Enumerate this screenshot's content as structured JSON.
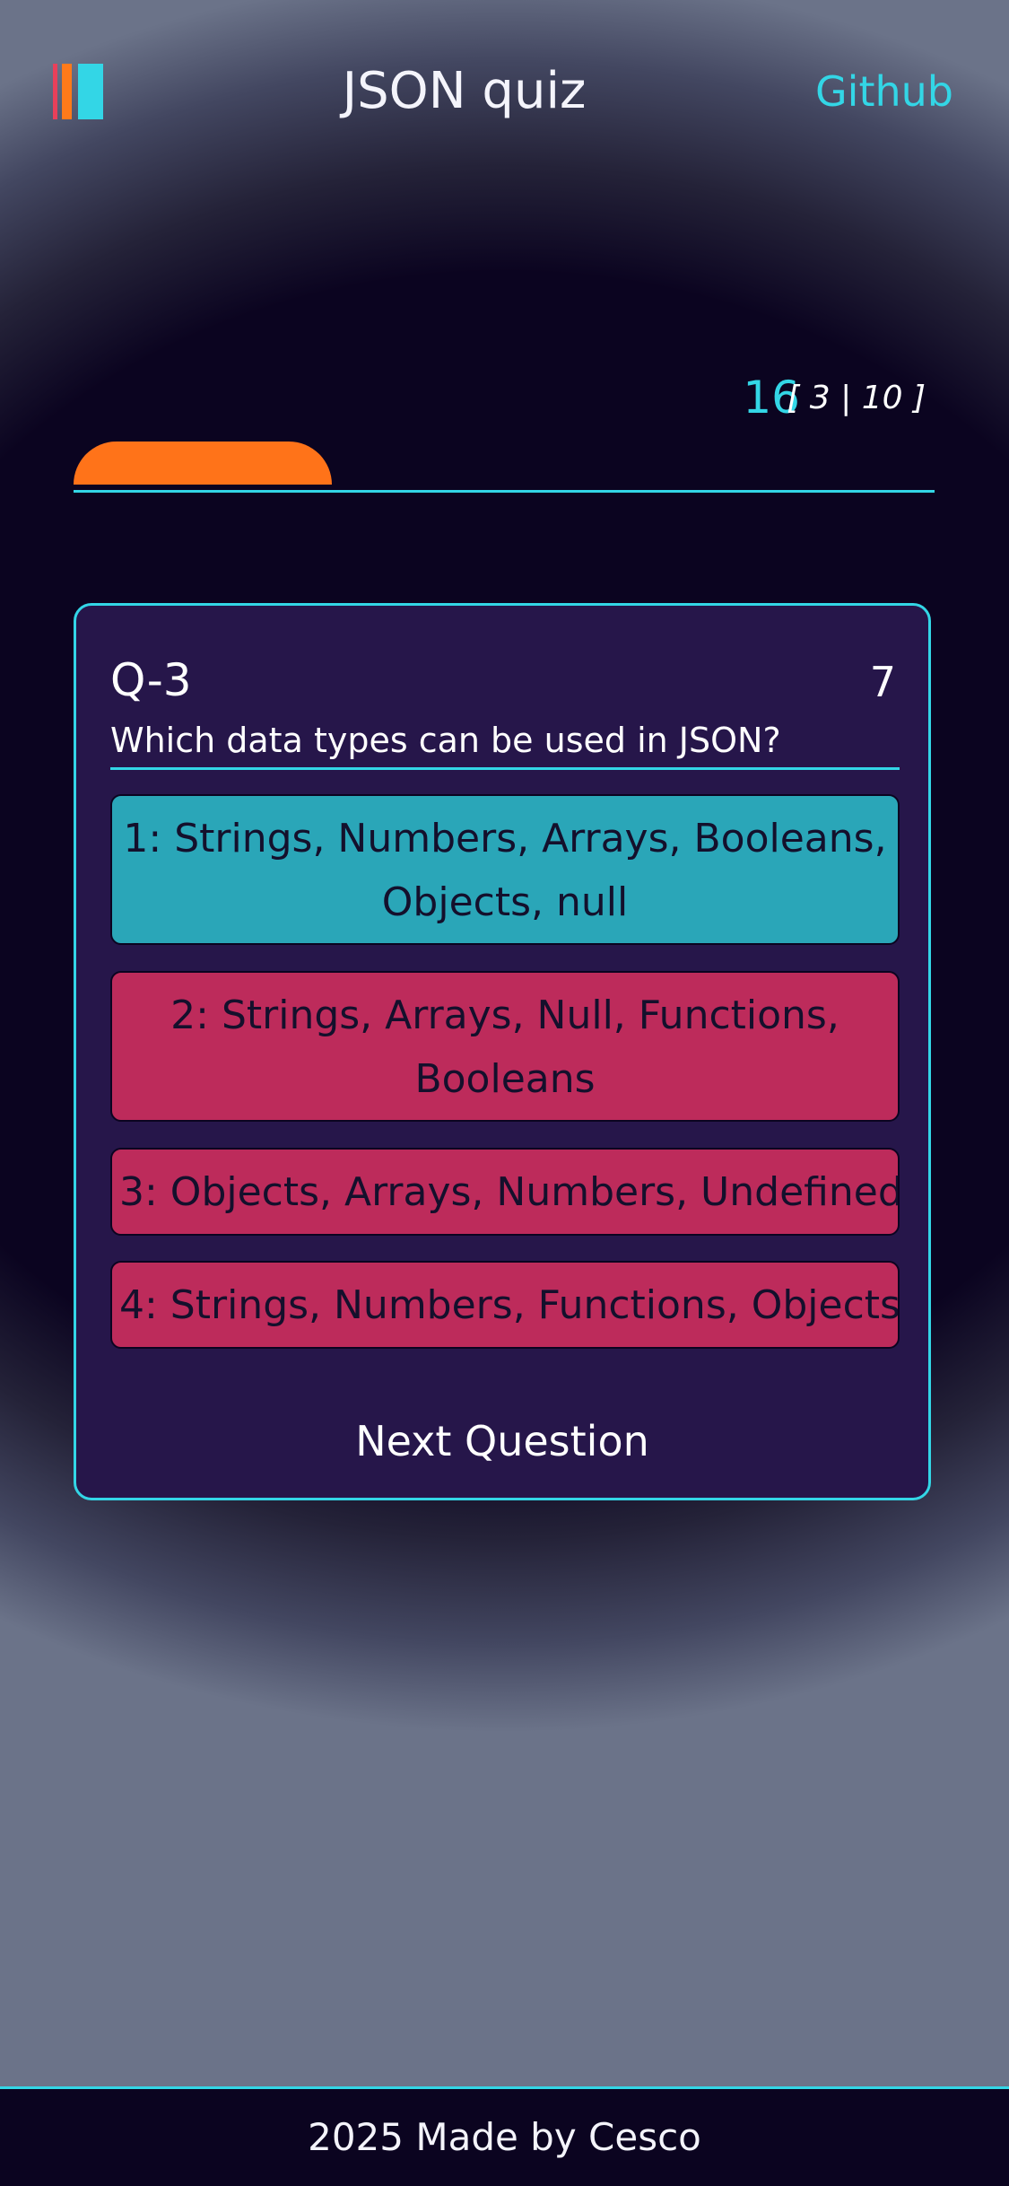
{
  "header": {
    "title": "JSON quiz",
    "github_label": "Github",
    "logo_colors": [
      "#e8405a",
      "#ff7a1a",
      "#33d6e6"
    ]
  },
  "progress": {
    "timer": "16",
    "counter": "[ 3 | 10 ]",
    "current": 3,
    "total": 10
  },
  "question": {
    "number_label": "Q-3",
    "points": "7",
    "text": "Which data types can be used in JSON?",
    "answers": [
      {
        "lines": [
          "1: Strings, Numbers, Arrays, Booleans,",
          "Objects, null"
        ],
        "state": "correct"
      },
      {
        "lines": [
          "2: Strings, Arrays, Null, Functions,",
          "Booleans"
        ],
        "state": "wrong"
      },
      {
        "lines": [
          "3: Objects, Arrays, Numbers, Undefined"
        ],
        "state": "wrong"
      },
      {
        "lines": [
          "4: Strings, Numbers, Functions, Objects"
        ],
        "state": "wrong"
      }
    ],
    "next_label": "Next Question"
  },
  "footer": {
    "text": "2025 Made by Cesco"
  },
  "colors": {
    "background": "#0b0420",
    "accent": "#33d6e6",
    "progress": "#ff7319",
    "card": "#26164a",
    "correct": "#2aa6b8",
    "wrong": "#bd2b5b"
  }
}
